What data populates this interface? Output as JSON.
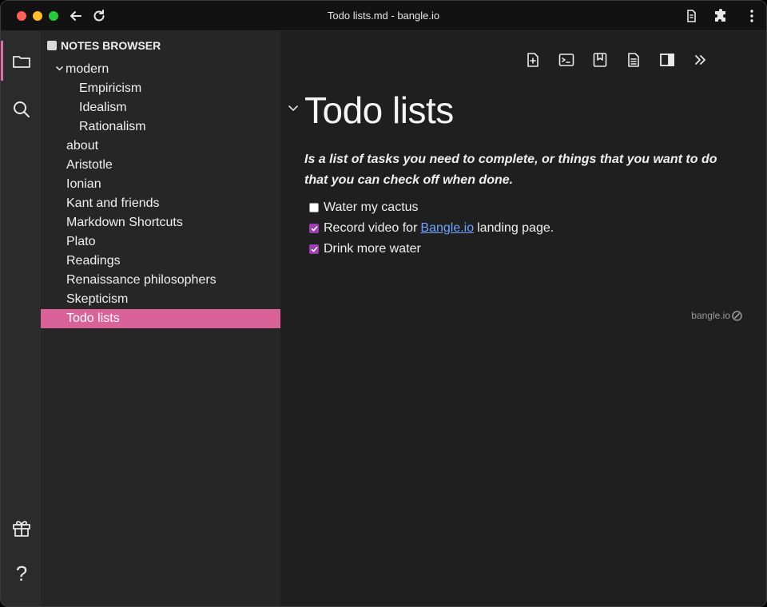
{
  "window": {
    "title": "Todo lists.md - bangle.io"
  },
  "activity_bar": {
    "items": [
      {
        "icon": "folder-icon"
      },
      {
        "icon": "search-icon"
      },
      {
        "icon": "gift-icon"
      },
      {
        "icon": "help-icon",
        "glyph": "?"
      }
    ]
  },
  "sidebar": {
    "header": "NOTES BROWSER",
    "tree": [
      {
        "label": "modern",
        "type": "folder",
        "expanded": true
      },
      {
        "label": "Empiricism",
        "type": "child"
      },
      {
        "label": "Idealism",
        "type": "child"
      },
      {
        "label": "Rationalism",
        "type": "child"
      },
      {
        "label": "about"
      },
      {
        "label": "Aristotle"
      },
      {
        "label": "Ionian"
      },
      {
        "label": "Kant and friends"
      },
      {
        "label": "Markdown Shortcuts"
      },
      {
        "label": "Plato"
      },
      {
        "label": "Readings"
      },
      {
        "label": "Renaissance philosophers"
      },
      {
        "label": "Skepticism"
      },
      {
        "label": "Todo lists",
        "active": true
      }
    ]
  },
  "editor": {
    "toolbar": [
      "new-note-icon",
      "terminal-icon",
      "bookmark-icon",
      "document-icon",
      "sidebar-icon",
      "double-chevron-right-icon"
    ],
    "heading": "Todo lists",
    "lead": "Is a list of tasks you need to complete, or things that you want to do that you can check off when done.",
    "tasks": [
      {
        "checked": false,
        "text": "Water my cactus"
      },
      {
        "checked": true,
        "before": "Record video for",
        "link": "Bangle.io",
        "after": "landing page."
      },
      {
        "checked": true,
        "text": "Drink more water"
      }
    ],
    "brand": "bangle.io"
  },
  "colors": {
    "accent": "#d96399",
    "checkbox": "#9c3db0",
    "link": "#6fa3ff"
  }
}
